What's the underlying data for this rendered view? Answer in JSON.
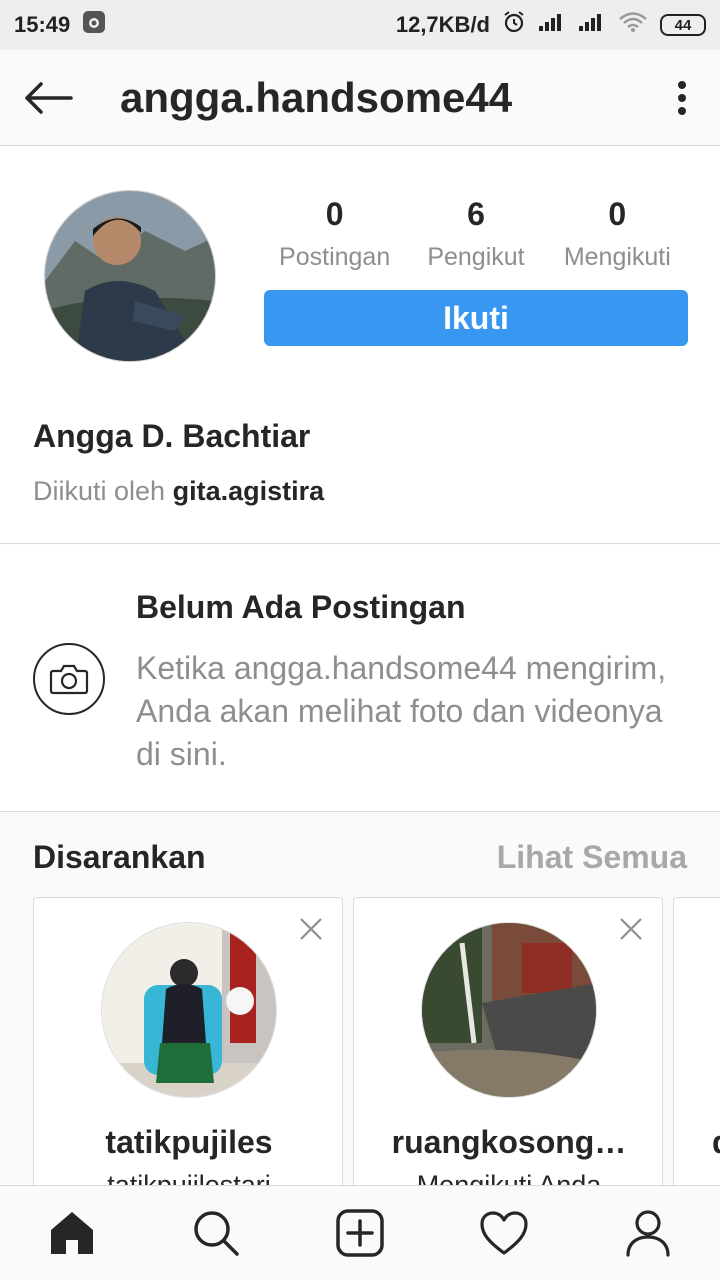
{
  "status_bar": {
    "time": "15:49",
    "network_speed": "12,7KB/d",
    "battery": "44"
  },
  "header": {
    "title": "angga.handsome44",
    "back_icon": "arrow-left-icon",
    "more_icon": "more-vertical-icon"
  },
  "profile": {
    "stats": [
      {
        "value": "0",
        "label": "Postingan"
      },
      {
        "value": "6",
        "label": "Pengikut"
      },
      {
        "value": "0",
        "label": "Mengikuti"
      }
    ],
    "follow_label": "Ikuti",
    "full_name": "Angga D. Bachtiar",
    "followed_by_prefix": "Diikuti oleh",
    "followed_by_user": "gita.agistira"
  },
  "empty_state": {
    "title": "Belum Ada Postingan",
    "description": "Ketika angga.handsome44 mengirim, Anda akan melihat foto dan videonya di sini.",
    "icon": "camera-icon"
  },
  "suggestions": {
    "title": "Disarankan",
    "see_all": "Lihat Semua",
    "cards": [
      {
        "username": "tatikpujiles",
        "subtitle": "tatikpujilestari"
      },
      {
        "username": "ruangkosong…",
        "subtitle": "Mengikuti Anda"
      },
      {
        "username": "d",
        "subtitle": ""
      }
    ]
  },
  "bottom_nav": {
    "items": [
      "home-icon",
      "search-icon",
      "add-post-icon",
      "heart-icon",
      "profile-icon"
    ]
  },
  "colors": {
    "accent": "#3897f0",
    "muted_text": "#8e8e8e",
    "primary_text": "#262626"
  }
}
